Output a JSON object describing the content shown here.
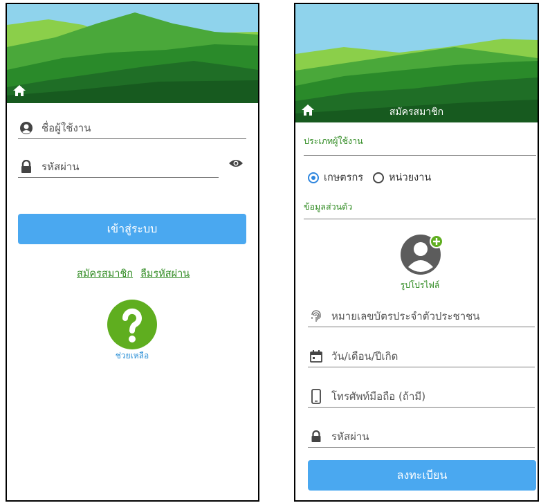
{
  "login": {
    "username_placeholder": "ชื่อผู้ใช้งาน",
    "password_placeholder": "รหัสผ่าน",
    "login_button": "เข้าสู่ระบบ",
    "register_link": "สมัครสมาชิก",
    "forgot_link": "ลืมรหัสผ่าน",
    "help_label": "ช่วยเหลือ"
  },
  "register": {
    "title": "สมัครสมาชิก",
    "user_type_label": "ประเภทผู้ใช้งาน",
    "user_type_options": [
      "เกษตรกร",
      "หน่วยงาน"
    ],
    "user_type_selected": "เกษตรกร",
    "personal_info_label": "ข้อมูลส่วนตัว",
    "profile_label": "รูปโปรไฟล์",
    "id_card_placeholder": "หมายเลขบัตรประจำตัวประชาชน",
    "birthdate_placeholder": "วัน/เดือน/ปีเกิด",
    "phone_placeholder": "โทรศัพท์มือถือ (ถ้ามี)",
    "password_placeholder": "รหัสผ่าน",
    "submit_button": "ลงทะเบียน"
  },
  "colors": {
    "accent_button": "#4aa8f0",
    "link_green": "#2e8a20",
    "help_green": "#5fae1f",
    "radio_selected": "#2e86de"
  },
  "icons": [
    "home-icon",
    "user-circle-icon",
    "lock-icon",
    "eye-icon",
    "help-icon",
    "fingerprint-icon",
    "calendar-icon",
    "phone-icon",
    "add-avatar-icon"
  ]
}
